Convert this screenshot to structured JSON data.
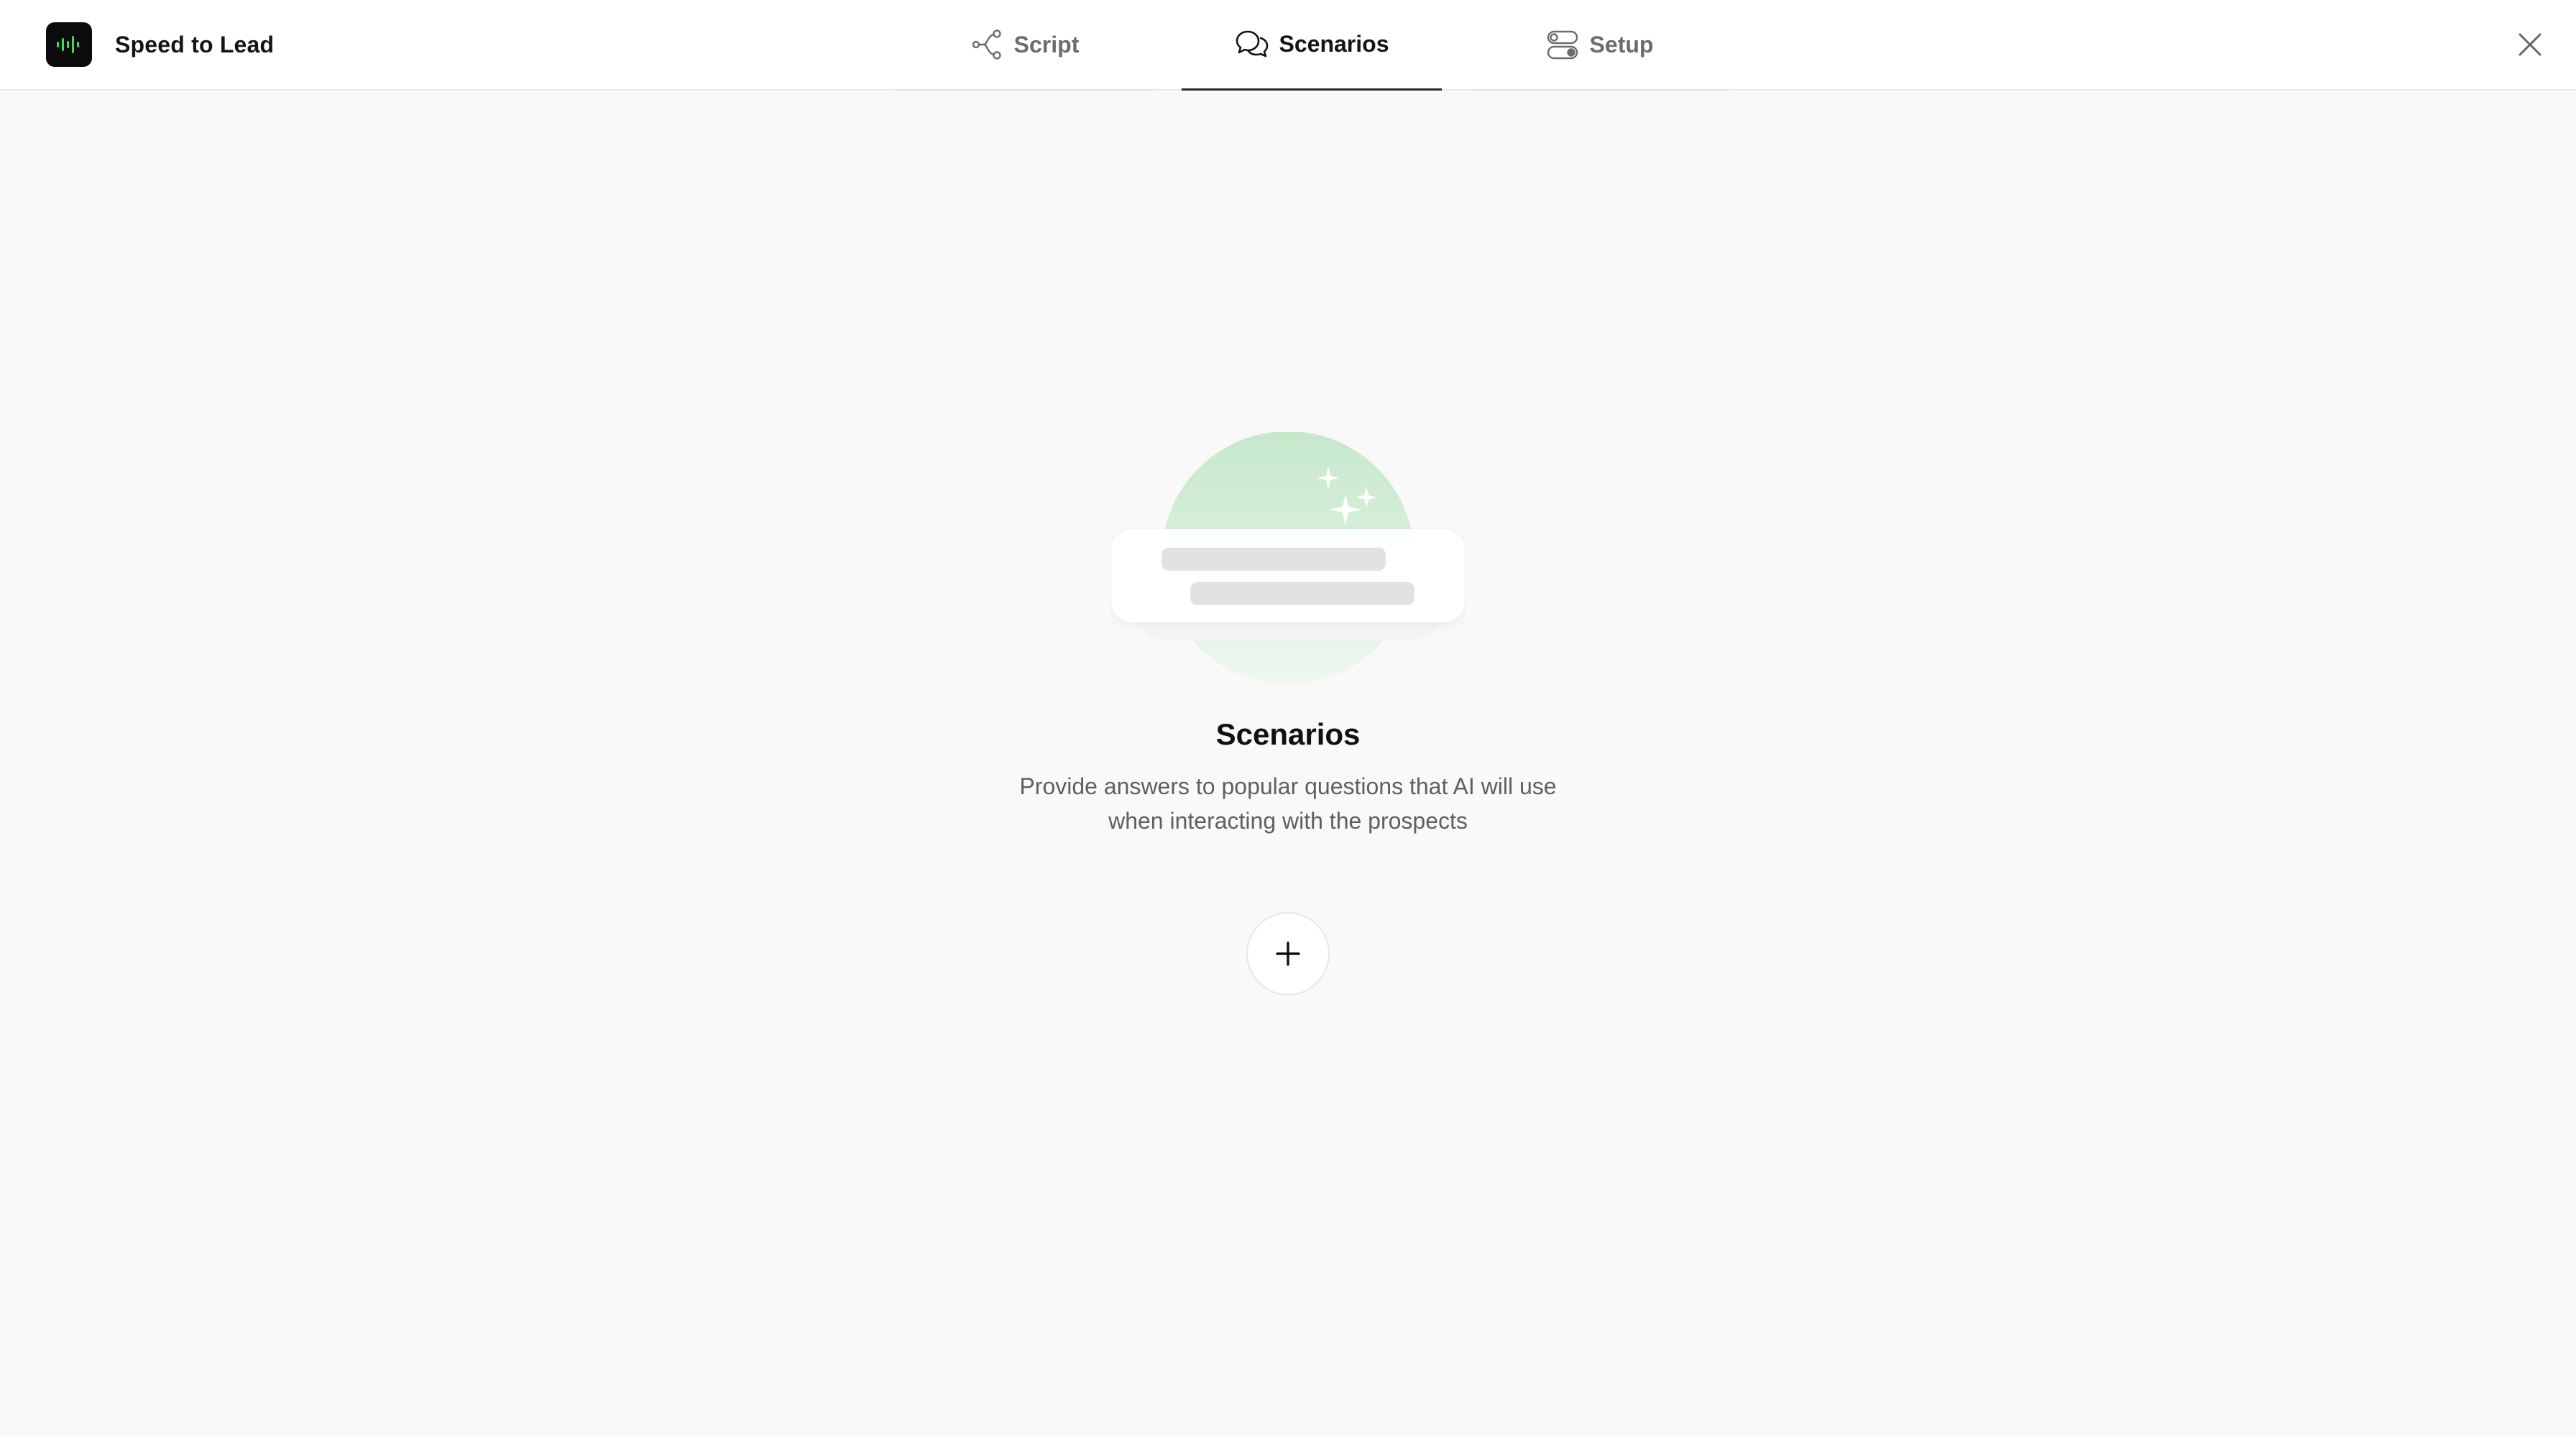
{
  "app": {
    "title": "Speed to Lead",
    "accent_color": "#3ddc5a"
  },
  "tabs": [
    {
      "label": "Script",
      "icon": "flow-branch-icon",
      "active": false
    },
    {
      "label": "Scenarios",
      "icon": "chat-bubbles-icon",
      "active": true
    },
    {
      "label": "Setup",
      "icon": "toggles-icon",
      "active": false
    }
  ],
  "empty_state": {
    "title": "Scenarios",
    "description": "Provide answers to popular questions that AI will use when interacting with the prospects",
    "add_icon": "plus-icon"
  },
  "close_icon": "close-icon"
}
